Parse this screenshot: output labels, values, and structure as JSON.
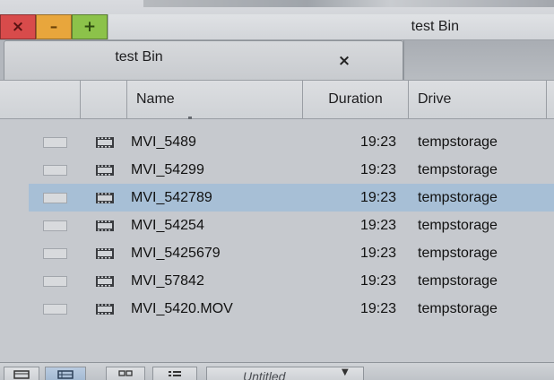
{
  "window": {
    "title": "test Bin",
    "controls": {
      "close_glyph": "×",
      "minimize_glyph": "–",
      "maximize_glyph": "+"
    }
  },
  "tab": {
    "label": "test Bin",
    "close_glyph": "×"
  },
  "columns": [
    "Name",
    "Duration",
    "Drive"
  ],
  "rows": [
    {
      "name": "MVI_5489",
      "duration": "19:23",
      "drive": "tempstorage",
      "icon": "clip-icon",
      "selected": false
    },
    {
      "name": "MVI_54299",
      "duration": "19:23",
      "drive": "tempstorage",
      "icon": "clip-icon",
      "selected": false
    },
    {
      "name": "MVI_542789",
      "duration": "19:23",
      "drive": "tempstorage",
      "icon": "clip-icon",
      "selected": true
    },
    {
      "name": "MVI_54254",
      "duration": "19:23",
      "drive": "tempstorage",
      "icon": "clip-icon",
      "selected": false
    },
    {
      "name": "MVI_5425679",
      "duration": "19:23",
      "drive": "tempstorage",
      "icon": "clip-icon",
      "selected": false
    },
    {
      "name": "MVI_57842",
      "duration": "19:23",
      "drive": "tempstorage",
      "icon": "clip-icon",
      "selected": false
    },
    {
      "name": "MVI_5420.MOV",
      "duration": "19:23",
      "drive": "tempstorage",
      "icon": "clip-icon",
      "selected": false
    }
  ],
  "bottom_toolbar": {
    "view_buttons": [
      {
        "icon": "brief-view-icon",
        "active": false
      },
      {
        "icon": "text-view-icon",
        "active": true
      },
      {
        "icon": "frame-view-icon",
        "active": false
      },
      {
        "icon": "script-view-icon",
        "active": false
      }
    ],
    "bin_view_select": {
      "value": "Untitled",
      "icon": "dropdown-arrow-icon"
    }
  },
  "colors": {
    "selected_row": "#a7bfd6",
    "close_button": "#d84b4b",
    "minimize_button": "#e8a63c",
    "maximize_button": "#8cc24a",
    "active_view_button": "#a3b9d2"
  }
}
